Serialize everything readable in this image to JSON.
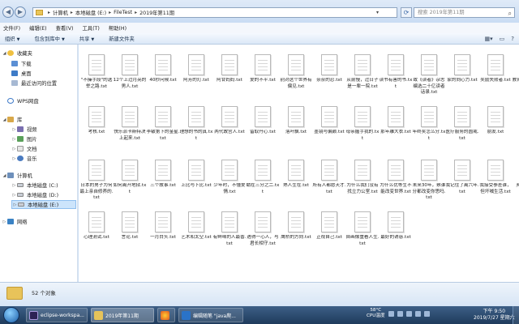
{
  "address": {
    "crumbs": [
      "计算机",
      "本地磁盘 (E:)",
      "FileTest",
      "2019年第11期"
    ],
    "separator": "▸"
  },
  "search": {
    "placeholder": "搜索 2019年第11期"
  },
  "menu": [
    "文件(F)",
    "编辑(E)",
    "查看(V)",
    "工具(T)",
    "帮助(H)"
  ],
  "toolbar": {
    "organize": "组织",
    "include": "包含到库中",
    "share": "共享",
    "new_folder": "新建文件夹"
  },
  "nav": {
    "favorites": "收藏夹",
    "downloads": "下载",
    "desktop": "桌面",
    "recent": "最近访问的位置",
    "wps": "WPS网盘",
    "libraries": "库",
    "videos": "视频",
    "pictures": "图片",
    "documents": "文档",
    "music": "音乐",
    "computer": "计算机",
    "drive_c": "本地磁盘 (C:)",
    "drive_d": "本地磁盘 (D:)",
    "drive_e": "本地磁盘 (E:)",
    "network": "网络"
  },
  "files": [
    [
      "\"不操手段\"的选举之路.txt",
      "12个上过月亮的男人.txt",
      "40秒问候.txt",
      "阿芳的灯.txt",
      "阿甘妈妈.txt",
      "爱的不平.txt",
      "别对这个世界有偏见.txt",
      "奈奈的忍.txt",
      "从前慢，过日子是一辈一院.txt",
      "读书有害的书.txt",
      "致《读者》杂志编选二十亿读者话录.txt",
      "家的向心力.txt",
      "奖励失败者.txt",
      "教育中的父母.txt"
    ],
    [
      "考核.txt",
      "快乐派卡斯特决上起来.txt",
      "李敏第下的金星.txt",
      "理想的书的真.txt",
      "两代故宫人.txt",
      "留取丹心.txt",
      "落叶飘.txt",
      "墨镜与偏颇.txt",
      "母亲握手我的.txt",
      "那年雕大衣.txt",
      "年终奖怎么分.txt",
      "医疗服务的圆戒.txt",
      "朋友.txt",
      "人像.txt"
    ],
    [
      "日本的男子为何最上亲自修养的.txt",
      "如何离开地狱.txt",
      "三个故事.txt",
      "上比与下比.txt",
      "少年时，不懂爱情.txt",
      "蜻在三分之二.txt",
      "熟人生在.txt",
      "所有人都愿天才.txt",
      "为什么我们没有找立力公室.txt",
      "为什么优等生不能改变世界.txt",
      "未来30年，察谁分都改变你思吗.txt",
      "我记住了离六年.txt",
      "我接受参差谁，但坏喊生活.txt",
      "乡村医生.txt"
    ],
    [
      "心理测试.txt",
      "言论.txt",
      "一月白头.txt",
      "艺术和太空.txt",
      "有鲜味的人最香.txt",
      "遇得一心人，与君长相守.txt",
      "鹰桥的方向.txt",
      "正视自己.txt",
      "自画像重看人生.txt",
      "最好的诱惑.txt"
    ]
  ],
  "status": {
    "count": "52 个对象"
  },
  "taskbar": {
    "eclipse": "eclipse-workspa...",
    "folder": "2019年第11期",
    "firefox": "",
    "record": "编辑随笔 \"java爬..."
  },
  "weather": {
    "temp": "58°C",
    "label": "CPU温度"
  },
  "clock": {
    "time": "下午 9:50",
    "date": "2019/7/27 星期六"
  }
}
